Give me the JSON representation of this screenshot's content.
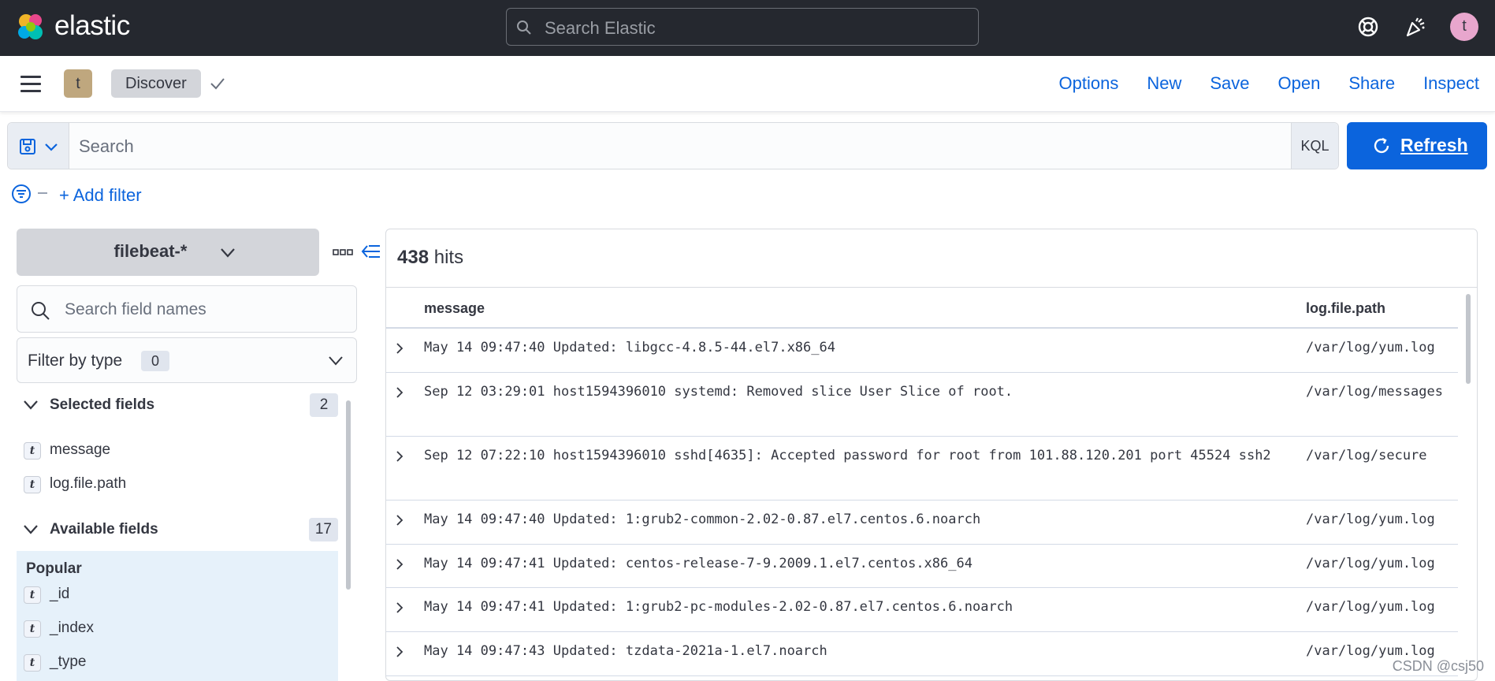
{
  "header": {
    "brand": "elastic",
    "search_placeholder": "Search Elastic",
    "user_initial": "t"
  },
  "appbar": {
    "space_initial": "t",
    "breadcrumb": "Discover",
    "nav": [
      "Options",
      "New",
      "Save",
      "Open",
      "Share",
      "Inspect"
    ]
  },
  "query": {
    "placeholder": "Search",
    "language": "KQL",
    "refresh_label": "Refresh"
  },
  "filters": {
    "add_filter_label": "+ Add filter"
  },
  "sidebar": {
    "index_pattern": "filebeat-*",
    "field_search_placeholder": "Search field names",
    "filter_by_type_label": "Filter by type",
    "filter_by_type_count": "0",
    "selected_fields": {
      "label": "Selected fields",
      "count": "2",
      "items": [
        {
          "type": "t",
          "name": "message"
        },
        {
          "type": "t",
          "name": "log.file.path"
        }
      ]
    },
    "available_fields": {
      "label": "Available fields",
      "count": "17",
      "popular_label": "Popular",
      "items": [
        {
          "type": "t",
          "name": "_id"
        },
        {
          "type": "t",
          "name": "_index"
        },
        {
          "type": "t",
          "name": "_type"
        }
      ]
    }
  },
  "results": {
    "hits_count": "438",
    "hits_label": "hits",
    "columns": [
      "message",
      "log.file.path"
    ],
    "rows": [
      {
        "message": "May 14 09:47:40 Updated: libgcc-4.8.5-44.el7.x86_64",
        "path": "/var/log/yum.log"
      },
      {
        "message": "Sep 12 03:29:01 host1594396010 systemd: Removed slice User Slice of root.",
        "path": "/var/log/messages"
      },
      {
        "message": "Sep 12 07:22:10 host1594396010 sshd[4635]: Accepted password for root from 101.88.120.201 port 45524 ssh2",
        "path": "/var/log/secure"
      },
      {
        "message": "May 14 09:47:40 Updated: 1:grub2-common-2.02-0.87.el7.centos.6.noarch",
        "path": "/var/log/yum.log"
      },
      {
        "message": "May 14 09:47:41 Updated: centos-release-7-9.2009.1.el7.centos.x86_64",
        "path": "/var/log/yum.log"
      },
      {
        "message": "May 14 09:47:41 Updated: 1:grub2-pc-modules-2.02-0.87.el7.centos.6.noarch",
        "path": "/var/log/yum.log"
      },
      {
        "message": "May 14 09:47:43 Updated: tzdata-2021a-1.el7.noarch",
        "path": "/var/log/yum.log"
      }
    ]
  },
  "watermark": "CSDN @csj50",
  "colors": {
    "header_bg": "#25282f",
    "accent": "#0b64dd",
    "popular_bg": "#e6f1fa"
  }
}
